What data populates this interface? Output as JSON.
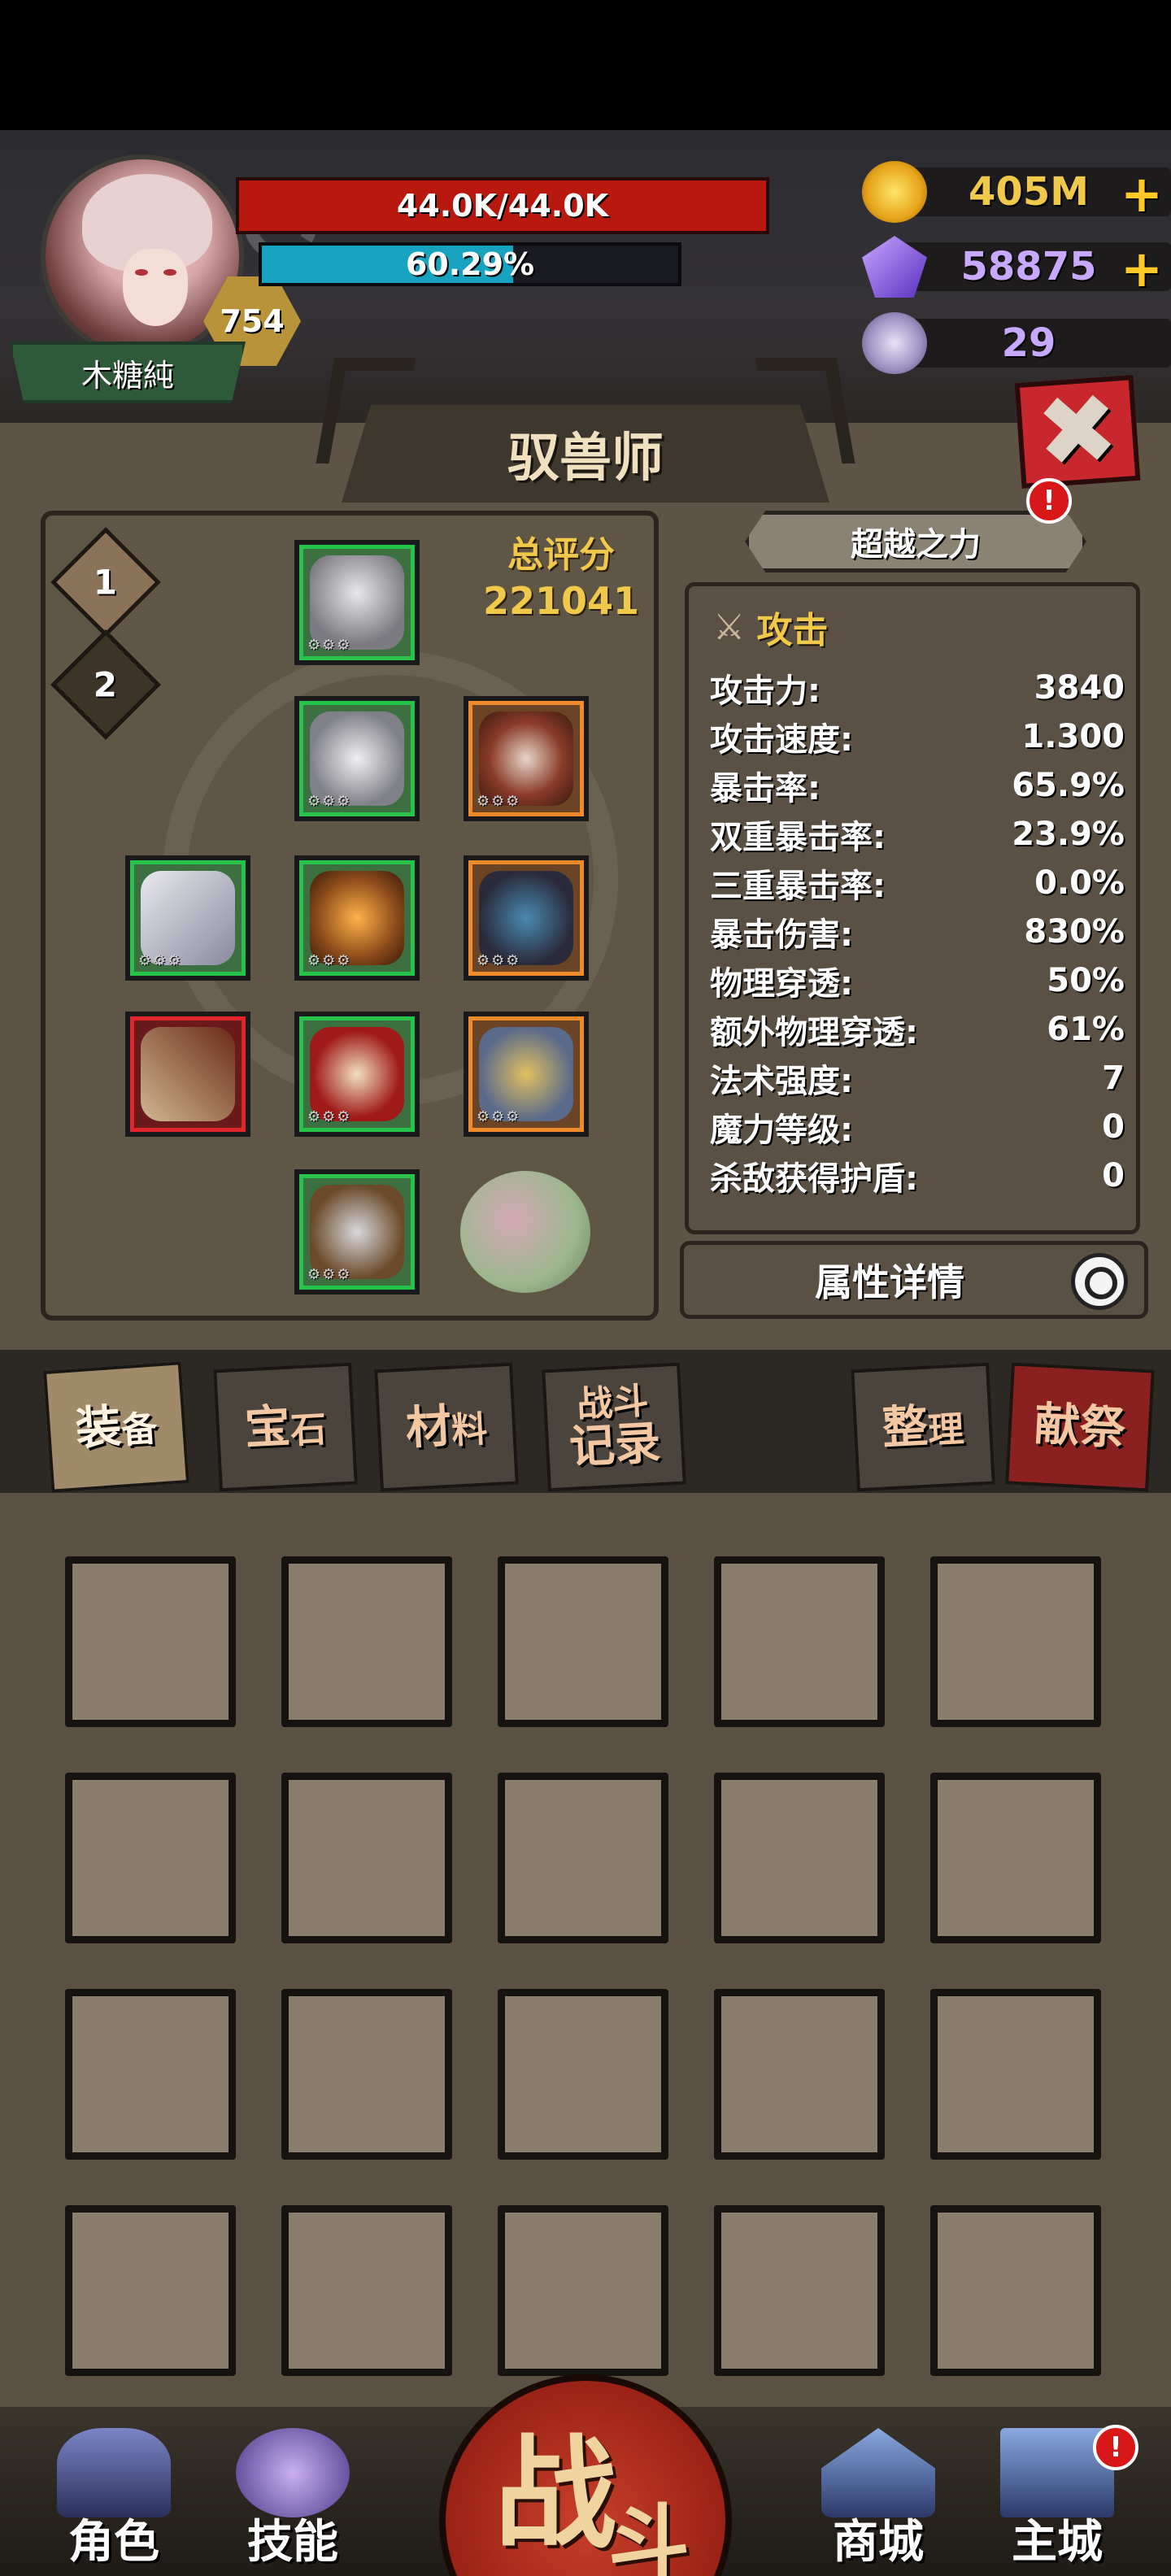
{
  "player": {
    "name": "木糖純",
    "level": "754",
    "hp_text": "44.0K/44.0K",
    "exp_text": "60.29%",
    "exp_fraction": 0.6029
  },
  "resources": {
    "gold": "405M",
    "gems": "58875",
    "skull_tokens": "29"
  },
  "panel": {
    "title": "驭兽师",
    "total_score_label": "总评分",
    "total_score": "221041",
    "page_tabs": [
      "1",
      "2"
    ],
    "transcend_label": "超越之力",
    "alert_mark": "!",
    "close_symbol": "✖",
    "equipment_stars": "⚙⚙⚙"
  },
  "stats": {
    "section_title": "攻击",
    "rows": [
      {
        "label": "攻击力:",
        "value": "3840"
      },
      {
        "label": "攻击速度:",
        "value": "1.300"
      },
      {
        "label": "暴击率:",
        "value": "65.9%"
      },
      {
        "label": "双重暴击率:",
        "value": "23.9%"
      },
      {
        "label": "三重暴击率:",
        "value": "0.0%"
      },
      {
        "label": "暴击伤害:",
        "value": "830%"
      },
      {
        "label": "物理穿透:",
        "value": "50%"
      },
      {
        "label": "额外物理穿透:",
        "value": "61%"
      },
      {
        "label": "法术强度:",
        "value": "7"
      },
      {
        "label": "魔力等级:",
        "value": "0"
      },
      {
        "label": "杀敌获得护盾:",
        "value": "0"
      }
    ],
    "detail_button": "属性详情"
  },
  "inventory_tabs": {
    "equipment_1": "装",
    "equipment_2": "备",
    "gems_1": "宝",
    "gems_2": "石",
    "materials_1": "材",
    "materials_2": "料",
    "battle_log_1": "战斗",
    "battle_log_2": "记录",
    "sort_1": "整",
    "sort_2": "理",
    "sacrifice": "献祭"
  },
  "bottom_nav": {
    "character": "角色",
    "skills": "技能",
    "fight_1": "战",
    "fight_2": "斗",
    "shop": "商城",
    "main_city": "主城"
  },
  "colors": {
    "hp": "#b8180e",
    "exp": "#17a3bf",
    "gold_text": "#f0c94a",
    "gem_text": "#c9a8ff",
    "skull_text": "#c9a8ff",
    "coin_text": "#f0c94a"
  }
}
